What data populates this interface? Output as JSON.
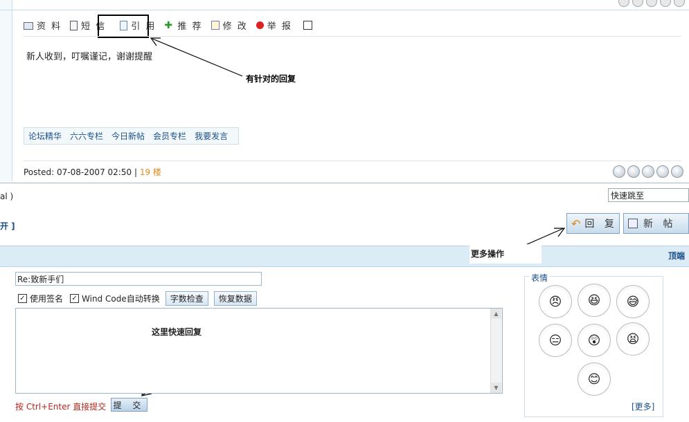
{
  "toolbar": {
    "items": [
      {
        "label": "资 料",
        "icon": "profile-card-icon"
      },
      {
        "label": "短 信",
        "icon": "message-doc-icon"
      },
      {
        "label": "引 用",
        "icon": "quote-doc-icon"
      },
      {
        "label": "推 荐",
        "icon": "recommend-plus-icon"
      },
      {
        "label": "修 改",
        "icon": "edit-icon"
      },
      {
        "label": "举 报",
        "icon": "report-stop-icon"
      }
    ]
  },
  "post": {
    "content": "新人收到，叮嘱谨记，谢谢提醒",
    "links": [
      "论坛精华",
      "六六专栏",
      "今日新帖",
      "会员专栏",
      "我要发言"
    ],
    "posted_prefix": "Posted: 07-08-2007 02:50",
    "separator": "|",
    "floor": "19 楼"
  },
  "annotations": {
    "quote_note": "有针对的回复",
    "more_ops": "更多操作",
    "quick_reply": "这里快速回复"
  },
  "nav": {
    "fragment_left1": "al )",
    "fragment_left2": "开 ]",
    "quick_jump": "快速跳至",
    "reply_button": "回 复",
    "new_post_button": "新 帖",
    "band_right": "顶端"
  },
  "reply_form": {
    "title_value": "Re:致新手们",
    "use_signature": "使用签名",
    "wind_code": "Wind Code自动转换",
    "char_check": "字数检查",
    "restore": "恢复数据",
    "hint": "按 Ctrl+Enter 直接提交",
    "submit": "提 交"
  },
  "emoticons": {
    "title": "表情",
    "more": "[更多]"
  }
}
